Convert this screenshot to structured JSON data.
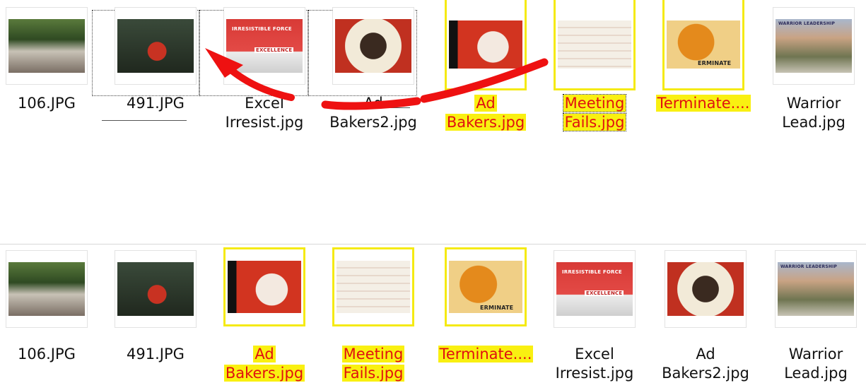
{
  "before_row": {
    "items": [
      {
        "file": "106.JPG"
      },
      {
        "file": "491.JPG"
      },
      {
        "line1": "Excel",
        "line2": "Irresist.jpg",
        "art_text_1": "IRRESISTIBLE FORCE",
        "art_text_2": "EXCELLENCE"
      },
      {
        "line1": "Ad",
        "line2": "Bakers2.jpg"
      },
      {
        "line1": "Ad",
        "line2": "Bakers.jpg"
      },
      {
        "line1": "Meeting",
        "line2": "Fails.jpg"
      },
      {
        "file": "Terminate....",
        "art_text": "ERMINATE"
      },
      {
        "line1": "Warrior",
        "line2": "Lead.jpg",
        "art_text": "WARRIOR LEADERSHIP"
      }
    ]
  },
  "after_row": {
    "items": [
      {
        "file": "106.JPG"
      },
      {
        "file": "491.JPG"
      },
      {
        "line1": "Ad",
        "line2": "Bakers.jpg"
      },
      {
        "line1": "Meeting",
        "line2": "Fails.jpg"
      },
      {
        "file": "Terminate....",
        "art_text": "ERMINATE"
      },
      {
        "line1": "Excel",
        "line2": "Irresist.jpg",
        "art_text_1": "IRRESISTIBLE FORCE",
        "art_text_2": "EXCELLENCE"
      },
      {
        "line1": "Ad",
        "line2": "Bakers2.jpg"
      },
      {
        "line1": "Warrior",
        "line2": "Lead.jpg",
        "art_text": "WARRIOR LEADERSHIP"
      }
    ]
  },
  "colors": {
    "selection_yellow": "#f9f011",
    "selected_text": "#e01010",
    "arrow": "#ee1111"
  }
}
